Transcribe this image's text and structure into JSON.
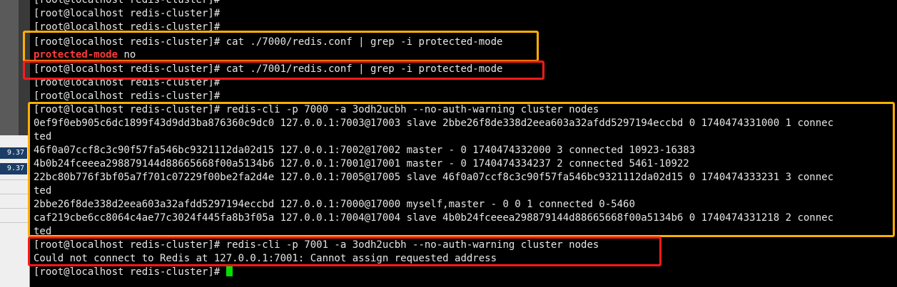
{
  "left_panel": {
    "values": [
      "9.37",
      "9.37"
    ]
  },
  "terminal": {
    "lines": [
      "[root@localhost redis-cluster]#",
      "[root@localhost redis-cluster]#",
      "[root@localhost redis-cluster]#",
      "[root@localhost redis-cluster]# cat ./7000/redis.conf | grep -i protected-mode",
      "",
      "[root@localhost redis-cluster]# cat ./7001/redis.conf | grep -i protected-mode",
      "[root@localhost redis-cluster]#",
      "[root@localhost redis-cluster]#",
      "[root@localhost redis-cluster]# redis-cli -p 7000 -a 3odh2ucbh --no-auth-warning cluster nodes",
      "0ef9f0eb905c6dc1899f43d9dd3ba876360c9dc0 127.0.0.1:7003@17003 slave 2bbe26f8de338d2eea603a32afdd5297194eccbd 0 1740474331000 1 connec",
      "ted",
      "46f0a07ccf8c3c90f57fa546bc9321112da02d15 127.0.0.1:7002@17002 master - 0 1740474332000 3 connected 10923-16383",
      "4b0b24fceeea298879144d88665668f00a5134b6 127.0.0.1:7001@17001 master - 0 1740474334237 2 connected 5461-10922",
      "22bc80b776f3bf05a7f701c07229f00be2fa2d4e 127.0.0.1:7005@17005 slave 46f0a07ccf8c3c90f57fa546bc9321112da02d15 0 1740474333231 3 connec",
      "ted",
      "2bbe26f8de338d2eea603a32afdd5297194eccbd 127.0.0.1:7000@17000 myself,master - 0 0 1 connected 0-5460",
      "caf219cbe6cc8064c4ae77c3024f445fa8b3f05a 127.0.0.1:7004@17004 slave 4b0b24fceeea298879144d88665668f00a5134b6 0 1740474331218 2 connec",
      "ted",
      "[root@localhost redis-cluster]# redis-cli -p 7001 -a 3odh2ucbh --no-auth-warning cluster nodes",
      "Could not connect to Redis at 127.0.0.1:7001: Cannot assign requested address",
      "[root@localhost redis-cluster]#"
    ],
    "grep_result": {
      "match": "protected-mode",
      "value": " no"
    }
  },
  "colors": {
    "highlight_orange": "#ffb000",
    "highlight_red": "#ff1a1a",
    "grep_match": "#ff3b3b",
    "cursor": "#00e000"
  }
}
